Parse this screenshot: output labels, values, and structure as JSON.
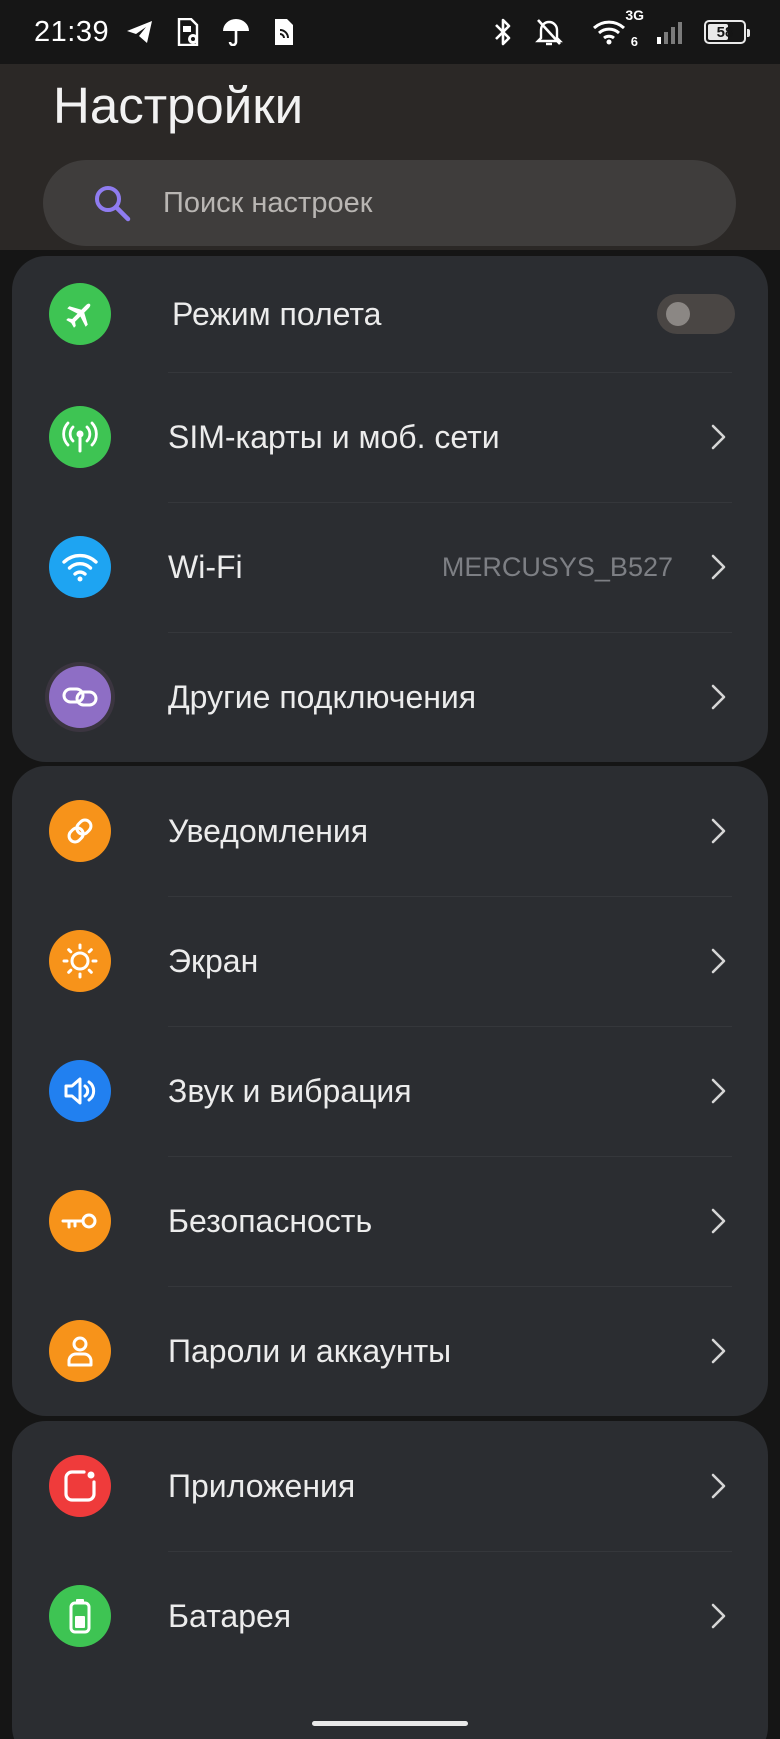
{
  "status_bar": {
    "time": "21:39",
    "battery_level": "58",
    "network_type": "3G",
    "wifi_sub": "6"
  },
  "header": {
    "title": "Настройки",
    "search_placeholder": "Поиск настроек"
  },
  "groups": [
    {
      "items": [
        {
          "label": "Режим полета",
          "icon": "airplane-icon",
          "color": "#3ec453",
          "control": "toggle",
          "toggle_on": false
        },
        {
          "label": "SIM-карты и моб. сети",
          "icon": "antenna-icon",
          "color": "#3ec453"
        },
        {
          "label": "Wi-Fi",
          "icon": "wifi-icon",
          "color": "#1ea4f2",
          "value": "MERCUSYS_B527"
        },
        {
          "label": "Другие подключения",
          "icon": "link-icon",
          "color": "#8e6ec5"
        }
      ]
    },
    {
      "items": [
        {
          "label": "Уведомления",
          "icon": "notification-link-icon",
          "color": "#f7931a"
        },
        {
          "label": "Экран",
          "icon": "sun-icon",
          "color": "#f7931a"
        },
        {
          "label": "Звук и вибрация",
          "icon": "speaker-icon",
          "color": "#2180f0"
        },
        {
          "label": "Безопасность",
          "icon": "key-icon",
          "color": "#f7931a"
        },
        {
          "label": "Пароли и аккаунты",
          "icon": "person-icon",
          "color": "#f7931a"
        }
      ]
    },
    {
      "items": [
        {
          "label": "Приложения",
          "icon": "apps-icon",
          "color": "#ef3b3b"
        },
        {
          "label": "Батарея",
          "icon": "battery-icon",
          "color": "#3ec453"
        }
      ]
    }
  ]
}
